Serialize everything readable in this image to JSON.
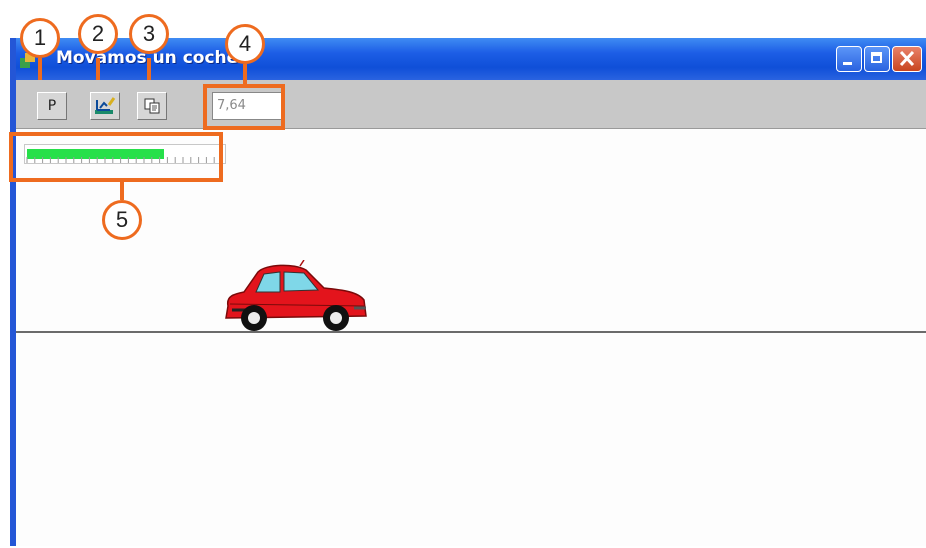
{
  "window": {
    "title": "Movamos un coche"
  },
  "toolbar": {
    "buttons": [
      {
        "label": "P",
        "icon": "pause-text-icon"
      },
      {
        "label": "",
        "icon": "edit-graph-icon"
      },
      {
        "label": "",
        "icon": "copy-icon"
      }
    ],
    "value_field": "7,64"
  },
  "progress": {
    "level_fraction": 0.7,
    "fill_color": "#27e04a"
  },
  "callouts": [
    "1",
    "2",
    "3",
    "4",
    "5"
  ],
  "colors": {
    "callout": "#ee6b1f",
    "titlebar": "#1d5ee6",
    "car": "#e3141c"
  }
}
